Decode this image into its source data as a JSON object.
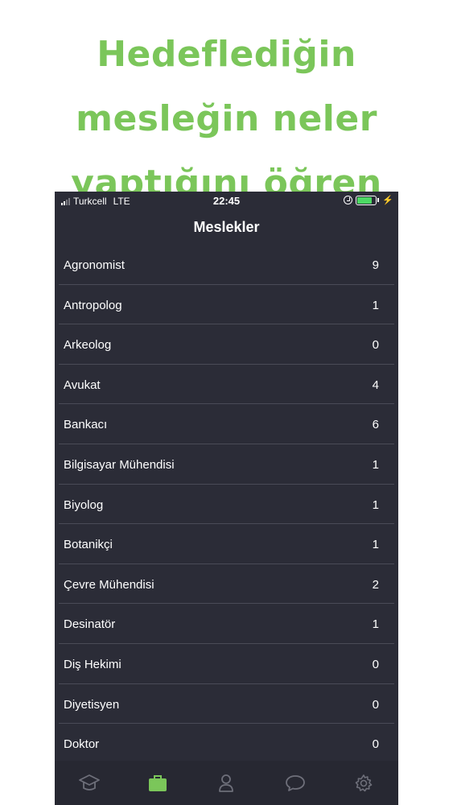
{
  "promo": {
    "lines": [
      "Hedeflediğin",
      "mesleğin neler",
      "yaptığını öğren"
    ]
  },
  "status_bar": {
    "carrier": "Turkcell",
    "network": "LTE",
    "time": "22:45"
  },
  "navbar": {
    "title": "Meslekler"
  },
  "professions": [
    {
      "name": "Agronomist",
      "count": "9"
    },
    {
      "name": "Antropolog",
      "count": "1"
    },
    {
      "name": "Arkeolog",
      "count": "0"
    },
    {
      "name": "Avukat",
      "count": "4"
    },
    {
      "name": "Bankacı",
      "count": "6"
    },
    {
      "name": "Bilgisayar Mühendisi",
      "count": "1"
    },
    {
      "name": "Biyolog",
      "count": "1"
    },
    {
      "name": "Botanikçi",
      "count": "1"
    },
    {
      "name": "Çevre Mühendisi",
      "count": "2"
    },
    {
      "name": "Desinatör",
      "count": "1"
    },
    {
      "name": "Diş Hekimi",
      "count": "0"
    },
    {
      "name": "Diyetisyen",
      "count": "0"
    },
    {
      "name": "Doktor",
      "count": "0"
    }
  ],
  "tabs": [
    {
      "icon": "graduation-cap-icon",
      "active": false
    },
    {
      "icon": "briefcase-icon",
      "active": true
    },
    {
      "icon": "person-icon",
      "active": false
    },
    {
      "icon": "chat-bubble-icon",
      "active": false
    },
    {
      "icon": "gear-icon",
      "active": false
    }
  ],
  "colors": {
    "promo_green": "#7bc65a",
    "background": "#2b2c37",
    "active_tab": "#7bc65a",
    "inactive_tab": "#6e6f7a",
    "battery": "#4cd964"
  }
}
